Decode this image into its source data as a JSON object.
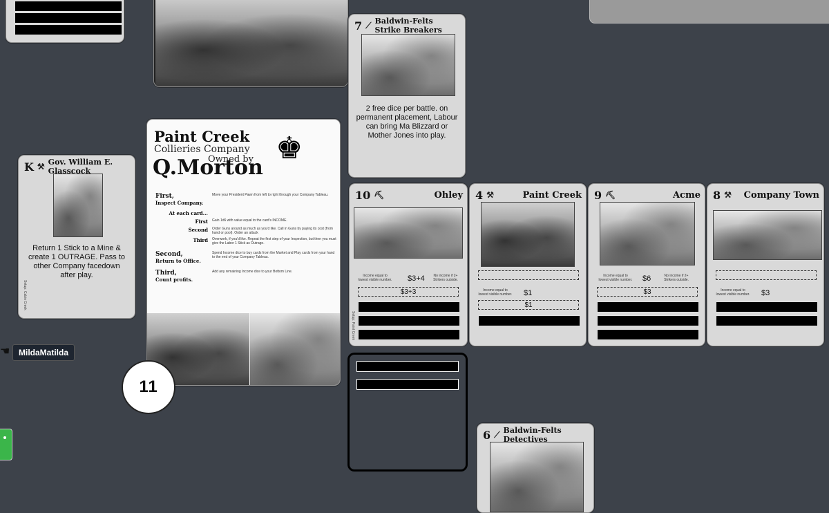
{
  "player": {
    "name": "MildaMatilda"
  },
  "round_token": {
    "value": "11"
  },
  "baldwin_strike": {
    "number": "7",
    "name": "Baldwin-Felts Strike Breakers",
    "text": "2 free dice per battle. on permanent placement, Labour can bring Ma Blizzard or Mother Jones into play."
  },
  "governor": {
    "number": "K",
    "name": "Gov. William E. Glasscock",
    "text": "Return 1 Stick to a Mine & create 1 OUTRAGE. Pass to other Company facedown after play.",
    "setup": "Setup: Cabin Creek"
  },
  "company_card": {
    "title1": "Paint Creek",
    "title2": "Collieries Company",
    "owned_by": "Owned by",
    "owner": "Q.Morton",
    "steps": [
      {
        "label": "First,",
        "sub": "Inspect Company.",
        "text": "Move your President Pawn from left to right through your Company Tableau."
      },
      {
        "label": "At each card...",
        "sub": "",
        "text": ""
      },
      {
        "label": "First",
        "sub": "",
        "text": "Gain 1d6 with value equal to the card's INCOME."
      },
      {
        "label": "Second",
        "sub": "",
        "text": "Order Guns around as much as you'd like. Call in Guns by paying its cost (from hand or pool). Order an attack"
      },
      {
        "label": "Third",
        "sub": "",
        "text": "Overwork, if you'd like. Repeat the first step of your Inspection, but then you must give the Labor 1 Stick as Outrage."
      },
      {
        "label": "Second,",
        "sub": "Return to Office.",
        "text": "Spend Income dice to buy cards from the Market and Play cards from your hand to the end of your Company Tableau."
      },
      {
        "label": "Third,",
        "sub": "Count profits.",
        "text": "Add any remaining Income dice to your Bottom Line."
      }
    ]
  },
  "mines": [
    {
      "number": "10",
      "name": "Ohley",
      "income_note": "Income equal to lowest visible number.",
      "strike_note": "No income if 2+ Strikers outside.",
      "value1": "$3+4",
      "value2": "$3+3",
      "setup": "Setup: Paint Creek"
    },
    {
      "number": "4",
      "name": "Paint Creek",
      "income_note": "Income equal to lowest visible number.",
      "value1": "$1",
      "value2": "$1",
      "setup": ""
    },
    {
      "number": "9",
      "name": "Acme",
      "income_note": "Income equal to lowest visible number.",
      "strike_note": "No income if 2+ Strikers outside.",
      "value1": "$6",
      "value2": "$3",
      "setup": ""
    },
    {
      "number": "8",
      "name": "Company Town",
      "income_note": "Income equal to lowest visible number.",
      "value1": "$3",
      "setup": ""
    }
  ],
  "baldwin_detectives": {
    "number": "6",
    "name": "Baldwin-Felts Detectives"
  }
}
